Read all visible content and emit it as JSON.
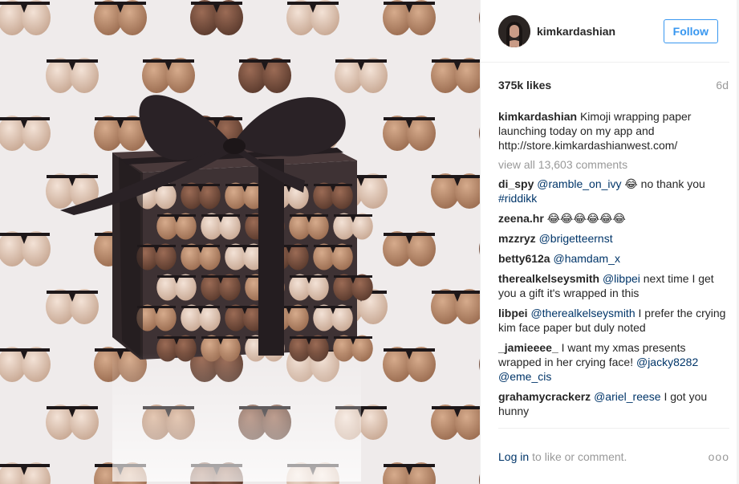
{
  "post": {
    "username": "kimkardashian",
    "follow_label": "Follow",
    "likes": "375k likes",
    "age": "6d",
    "view_all": "view all 13,603 comments",
    "login_label": "Log in",
    "login_rest": "to like or comment.",
    "more_label": "ooo"
  },
  "comments": [
    {
      "user": "kimkardashian",
      "parts": [
        {
          "t": "Kimoji wrapping paper launching today on my app and http://store.kimkardashianwest.com/"
        }
      ]
    },
    {
      "user": "di_spy",
      "parts": [
        {
          "t": "@ramble_on_ivy",
          "m": true
        },
        {
          "t": " 😂 no thank you "
        },
        {
          "t": "#riddikk",
          "m": true
        }
      ]
    },
    {
      "user": "zeena.hr",
      "parts": [
        {
          "t": "😂😂😂😂😂😂"
        }
      ]
    },
    {
      "user": "mzzryz",
      "parts": [
        {
          "t": "@brigetteernst",
          "m": true
        }
      ]
    },
    {
      "user": "betty612a",
      "parts": [
        {
          "t": "@hamdam_x",
          "m": true
        }
      ]
    },
    {
      "user": "therealkelseysmith",
      "parts": [
        {
          "t": "@libpei",
          "m": true
        },
        {
          "t": " next time I get you a gift it's wrapped in this"
        }
      ]
    },
    {
      "user": "libpei",
      "parts": [
        {
          "t": "@therealkelseysmith",
          "m": true
        },
        {
          "t": " I prefer the crying kim face paper but duly noted"
        }
      ]
    },
    {
      "user": "_jamieeee_",
      "parts": [
        {
          "t": "I want my xmas presents wrapped in her crying face! "
        },
        {
          "t": "@jacky8282",
          "m": true
        },
        {
          "t": " "
        },
        {
          "t": "@eme_cis",
          "m": true
        }
      ]
    },
    {
      "user": "grahamycrackerz",
      "parts": [
        {
          "t": "@ariel_reese",
          "m": true
        },
        {
          "t": " I got you hunny"
        }
      ]
    }
  ],
  "colors": {
    "accent": "#3897f0",
    "mention": "#003569",
    "muted": "#999999",
    "ribbon": "#2a2226"
  }
}
